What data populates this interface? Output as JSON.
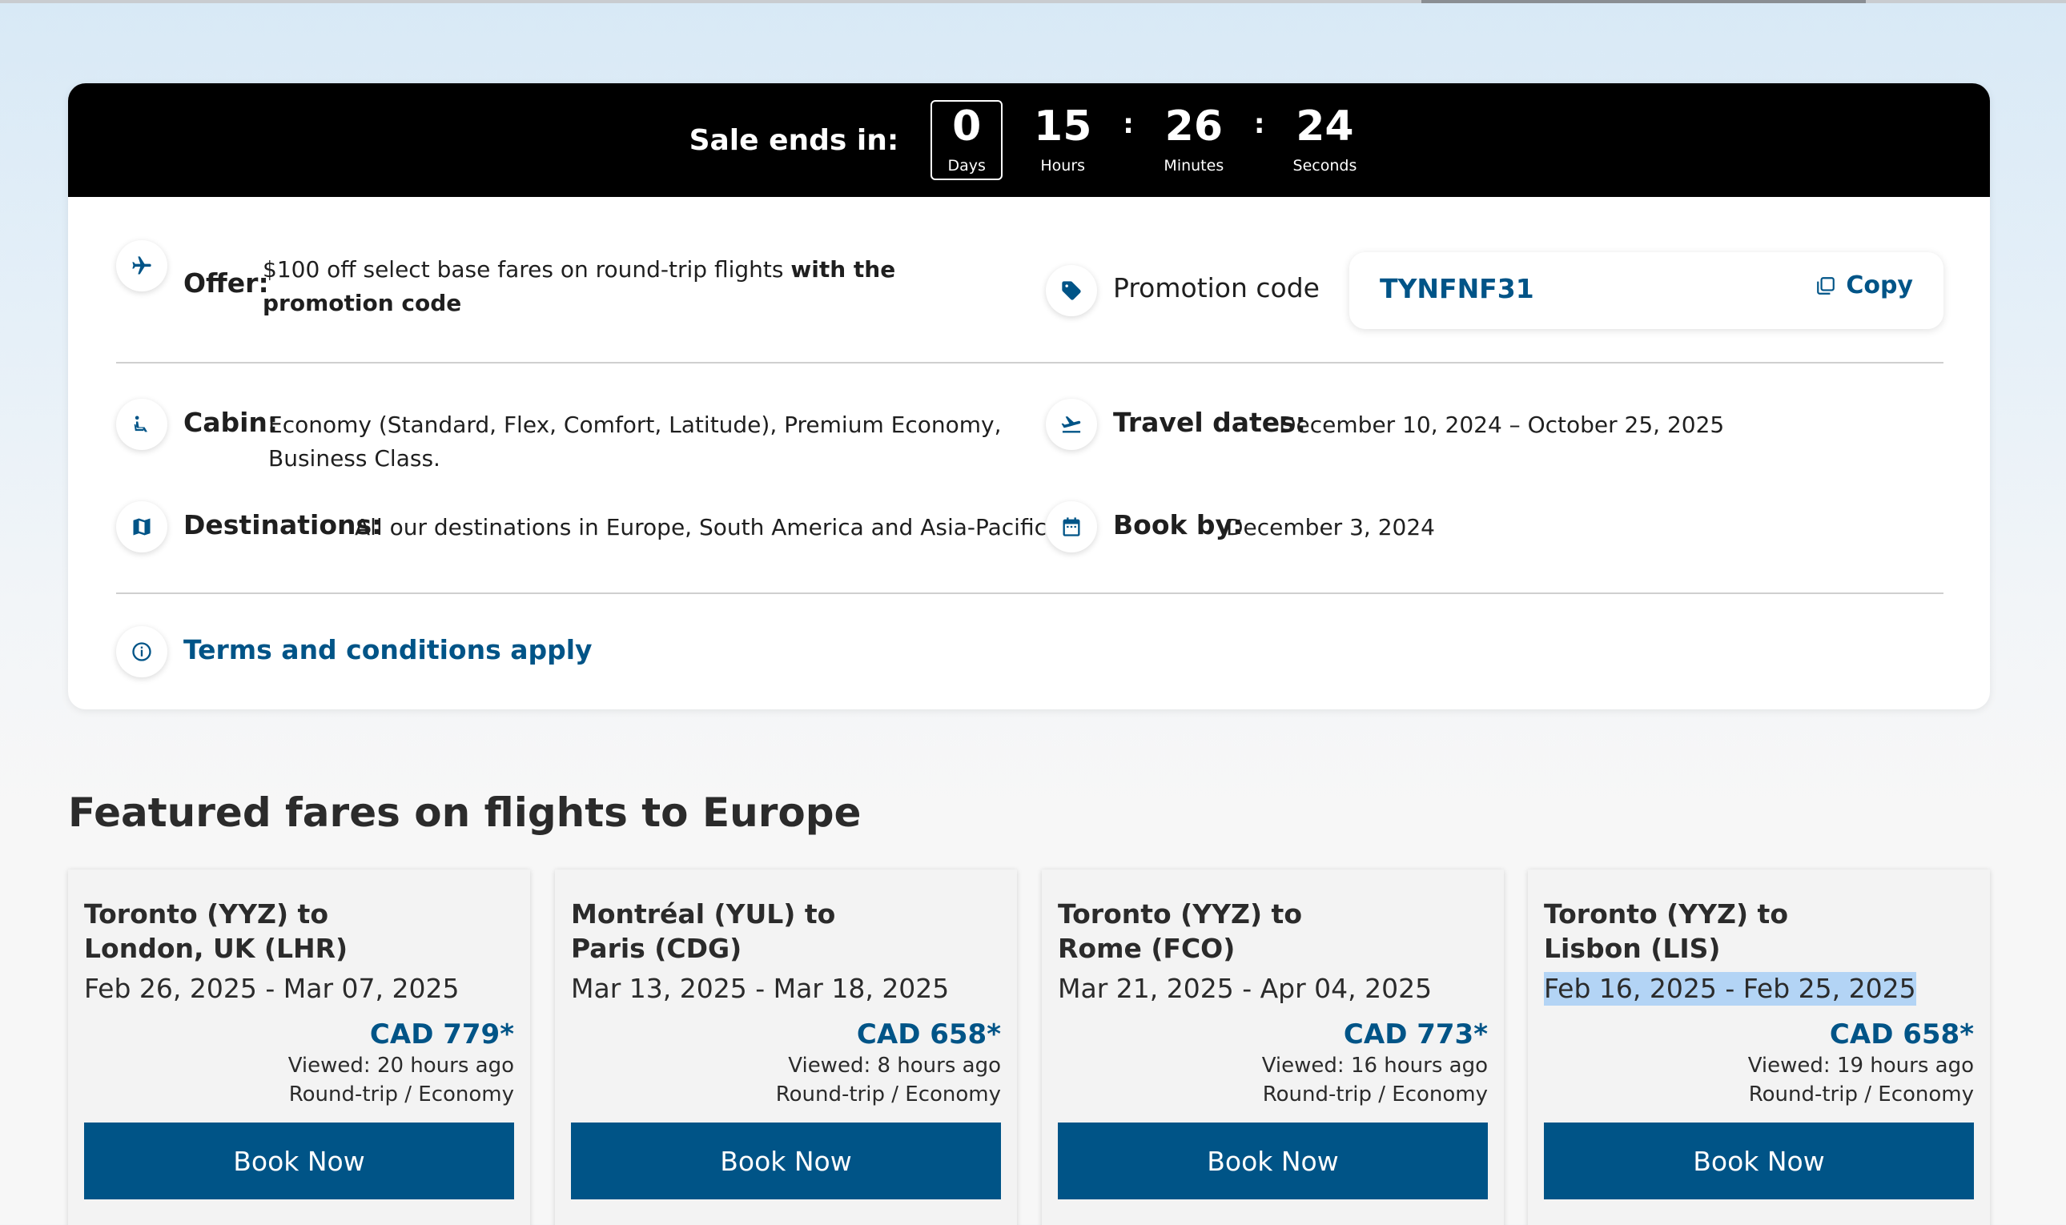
{
  "countdown": {
    "label": "Sale ends in:",
    "days": "0",
    "days_label": "Days",
    "hours": "15",
    "hours_label": "Hours",
    "minutes": "26",
    "minutes_label": "Minutes",
    "seconds": "24",
    "seconds_label": "Seconds",
    "separator": ":"
  },
  "offer": {
    "label": "Offer:",
    "text": "$100 off select base fares on round-trip flights ",
    "text_bold": "with the promotion code"
  },
  "promotion": {
    "label": "Promotion code",
    "code": "TYNFNF31",
    "copy_label": "Copy"
  },
  "cabin": {
    "label": "Cabin:",
    "line1": "Economy (Standard, Flex, Comfort, Latitude), Premium Economy,",
    "line2": "Business Class."
  },
  "travel_dates": {
    "label": "Travel dates:",
    "value": "December 10, 2024 – October 25, 2025"
  },
  "destinations": {
    "label": "Destinations:",
    "value": "All our destinations in Europe, South America and Asia-Pacific."
  },
  "book_by": {
    "label": "Book by:",
    "value": "December 3, 2024"
  },
  "terms": {
    "label": "Terms and conditions apply"
  },
  "featured": {
    "title": "Featured fares on flights to Europe",
    "cards": [
      {
        "route_line1": "Toronto (YYZ) to",
        "route_line2": "London, UK (LHR)",
        "dates": "Feb 26, 2025 - Mar 07, 2025",
        "price": "CAD 779*",
        "viewed": "Viewed: 20 hours ago",
        "fare": "Round-trip / Economy",
        "button": "Book Now"
      },
      {
        "route_line1": "Montréal (YUL) to",
        "route_line2": "Paris (CDG)",
        "dates": "Mar 13, 2025 - Mar 18, 2025",
        "price": "CAD 658*",
        "viewed": "Viewed: 8 hours ago",
        "fare": "Round-trip / Economy",
        "button": "Book Now"
      },
      {
        "route_line1": "Toronto (YYZ) to",
        "route_line2": "Rome (FCO)",
        "dates": "Mar 21, 2025 - Apr 04, 2025",
        "price": "CAD 773*",
        "viewed": "Viewed: 16 hours ago",
        "fare": "Round-trip / Economy",
        "button": "Book Now"
      },
      {
        "route_line1": "Toronto (YYZ) to",
        "route_line2": "Lisbon (LIS)",
        "dates": "Feb 16, 2025 - Feb 25, 2025",
        "price": "CAD 658*",
        "viewed": "Viewed: 19 hours ago",
        "fare": "Round-trip / Economy",
        "button": "Book Now"
      }
    ]
  },
  "colors": {
    "accent": "#005487",
    "countdown_bg": "#000000",
    "selection": "#b3d4f5"
  },
  "icons": [
    "plane-icon",
    "tag-icon",
    "copy-icon",
    "seat-icon",
    "departure-icon",
    "map-icon",
    "calendar-icon",
    "info-icon"
  ]
}
